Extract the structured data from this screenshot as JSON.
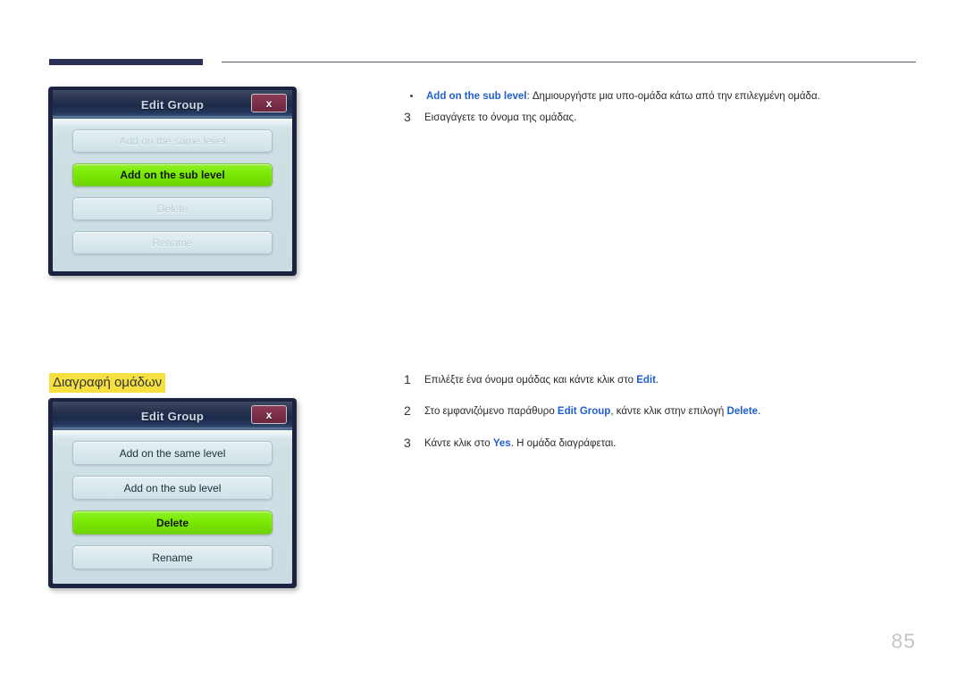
{
  "header": {
    "rule_color": "#2b3154"
  },
  "dialog_one": {
    "title": "Edit Group",
    "close_label": "x",
    "options": [
      {
        "label": "Add on the same level",
        "state": "dim"
      },
      {
        "label": "Add on the sub level",
        "state": "selected"
      },
      {
        "label": "Delete",
        "state": "dim"
      },
      {
        "label": "Rename",
        "state": "dim"
      }
    ]
  },
  "dialog_two": {
    "title": "Edit Group",
    "close_label": "x",
    "options": [
      {
        "label": "Add on the same level",
        "state": "normal"
      },
      {
        "label": "Add on the sub level",
        "state": "normal"
      },
      {
        "label": "Delete",
        "state": "selected"
      },
      {
        "label": "Rename",
        "state": "normal"
      }
    ]
  },
  "top_content": {
    "bullet": {
      "term": "Add on the sub level",
      "separator": ":",
      "description": " Δημιουργήστε μια υπο-ομάδα κάτω από την επιλεγμένη ομάδα."
    },
    "step3": {
      "number": "3",
      "text": "Εισαγάγετε το όνομα της ομάδας."
    }
  },
  "section": {
    "heading": "Διαγραφή ομάδων",
    "highlight_color": "#f5e03f",
    "steps": [
      {
        "number": "1",
        "pre": "Επιλέξτε ένα όνομα ομάδας και κάντε κλικ στο ",
        "link": "Edit",
        "post": "."
      },
      {
        "number": "2",
        "pre": "Στο εμφανιζόμενο παράθυρο ",
        "link": "Edit Group",
        "mid": ", κάντε κλικ στην επιλογή ",
        "link2": "Delete",
        "post": "."
      },
      {
        "number": "3",
        "pre": "Κάντε κλικ στο ",
        "link": "Yes",
        "post": ". Η ομάδα διαγράφεται."
      }
    ]
  },
  "footer": {
    "page_number": "85"
  }
}
